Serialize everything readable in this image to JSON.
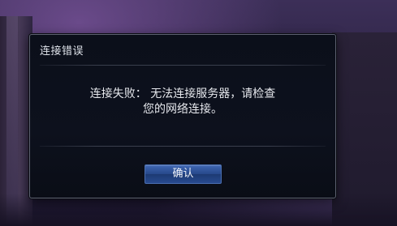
{
  "dialog": {
    "title": "连接错误",
    "message_line1": "连接失败： 无法连接服务器，请检查",
    "message_line2": "您的网络连接。",
    "confirm_label": "确认"
  }
}
